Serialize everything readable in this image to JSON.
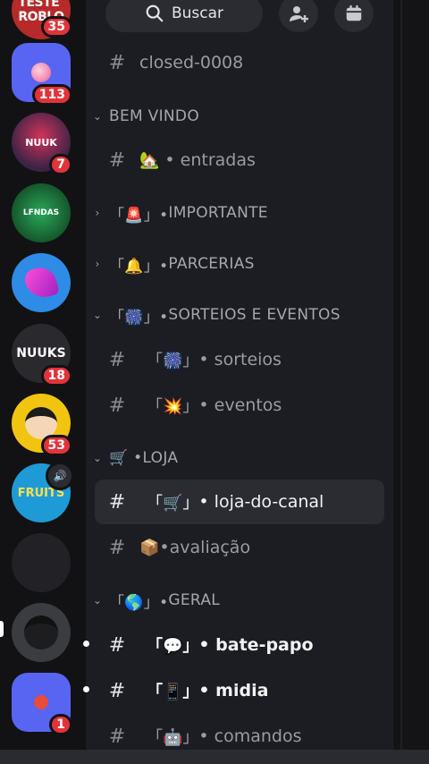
{
  "header": {
    "search_label": "Buscar"
  },
  "servers": [
    {
      "name": "server-1",
      "badge": "35",
      "color": "#c22d2d",
      "label": "TESTE\nROBLO"
    },
    {
      "name": "server-2",
      "badge": "113",
      "color": "#5865f2",
      "label": ""
    },
    {
      "name": "server-3",
      "badge": "7",
      "color": "#3a2345",
      "label": "NUUK"
    },
    {
      "name": "server-4",
      "badge": "",
      "color": "#1f7a3a",
      "label": "LFNDAS"
    },
    {
      "name": "server-5",
      "badge": "",
      "color": "#2e8be6",
      "label": ""
    },
    {
      "name": "server-6",
      "badge": "18",
      "color": "#2a2a2e",
      "label": "NUUKS"
    },
    {
      "name": "server-7",
      "badge": "53",
      "color": "#f1c40f",
      "label": ""
    },
    {
      "name": "server-8",
      "badge": "",
      "color": "#1e9bd7",
      "label": "FRUITS"
    },
    {
      "name": "server-9",
      "badge": "",
      "color": "#2a2a2c",
      "label": ""
    },
    {
      "name": "server-10",
      "badge": "",
      "color": "#3b3c40",
      "label": ""
    },
    {
      "name": "server-11",
      "badge": "1",
      "color": "#5865f2",
      "label": ""
    }
  ],
  "channels": {
    "top": {
      "name": "closed-0008"
    },
    "cat_bem_vindo": "BEM VINDO",
    "entradas": {
      "emoji": "🏡",
      "name": "• entradas"
    },
    "cat_importante": {
      "prefix": "「🚨」• ",
      "name": "IMPORTANTE"
    },
    "cat_parcerias": {
      "prefix": "「🔔」• ",
      "name": "PARCERIAS"
    },
    "cat_sorteios": {
      "prefix": "「🎆」• ",
      "name": "SORTEIOS E EVENTOS"
    },
    "sorteios": {
      "emoji": "「🎆」",
      "name": "• sorteios"
    },
    "eventos": {
      "emoji": "「💥」",
      "name": "• eventos"
    },
    "cat_loja": {
      "prefix": "🛒 • ",
      "name": "LOJA"
    },
    "loja": {
      "emoji": "「🛒」",
      "name": "• loja-do-canal"
    },
    "avaliacao": {
      "emoji": "📦",
      "name": "•avaliação"
    },
    "cat_geral": {
      "prefix": "「🌎」• ",
      "name": "GERAL"
    },
    "batepapo": {
      "emoji": "「💬」",
      "name": "• bate-papo"
    },
    "midia": {
      "emoji": "「📱」",
      "name": "• midia"
    },
    "comandos": {
      "emoji": "「🤖」",
      "name": "• comandos"
    }
  },
  "colors": {
    "accent": "#5865f2",
    "badge": "#e2333a"
  }
}
